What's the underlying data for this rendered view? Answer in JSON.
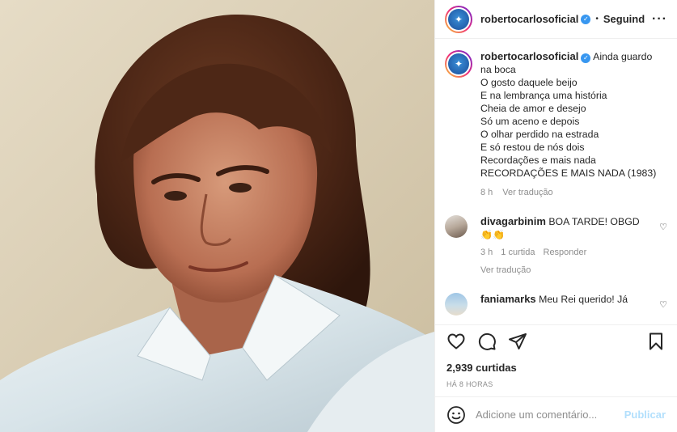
{
  "post": {
    "author": "robertocarlosoficial",
    "verified": true,
    "follow_label": "Seguind",
    "more_icon": "more-horizontal-icon"
  },
  "caption": {
    "username": "robertocarlosoficial",
    "lines": [
      "Ainda guardo",
      "na boca",
      "O gosto daquele beijo",
      "E na lembrança uma história",
      "Cheia de amor e desejo",
      "Só um aceno e depois",
      "O olhar perdido na estrada",
      "E só restou de nós dois",
      "Recordações e mais nada",
      "RECORDAÇÕES E MAIS NADA (1983)"
    ],
    "time": "8 h",
    "translate": "Ver tradução"
  },
  "comments": [
    {
      "username": "divagarbinim",
      "text": "BOA TARDE! OBGD",
      "emoji": "👏👏",
      "time": "3 h",
      "likes": "1 curtida",
      "reply": "Responder",
      "translate": "Ver tradução"
    },
    {
      "username": "faniamarks",
      "text": "Meu Rei querido! Já"
    }
  ],
  "stats": {
    "likes": "2,939 curtidas",
    "time": "HÁ 8 HORAS"
  },
  "composer": {
    "placeholder": "Adicione um comentário...",
    "publish": "Publicar"
  },
  "colors": {
    "verified": "#3897f0",
    "publish_disabled": "#b2dffc",
    "muted": "#8e8e8e"
  }
}
